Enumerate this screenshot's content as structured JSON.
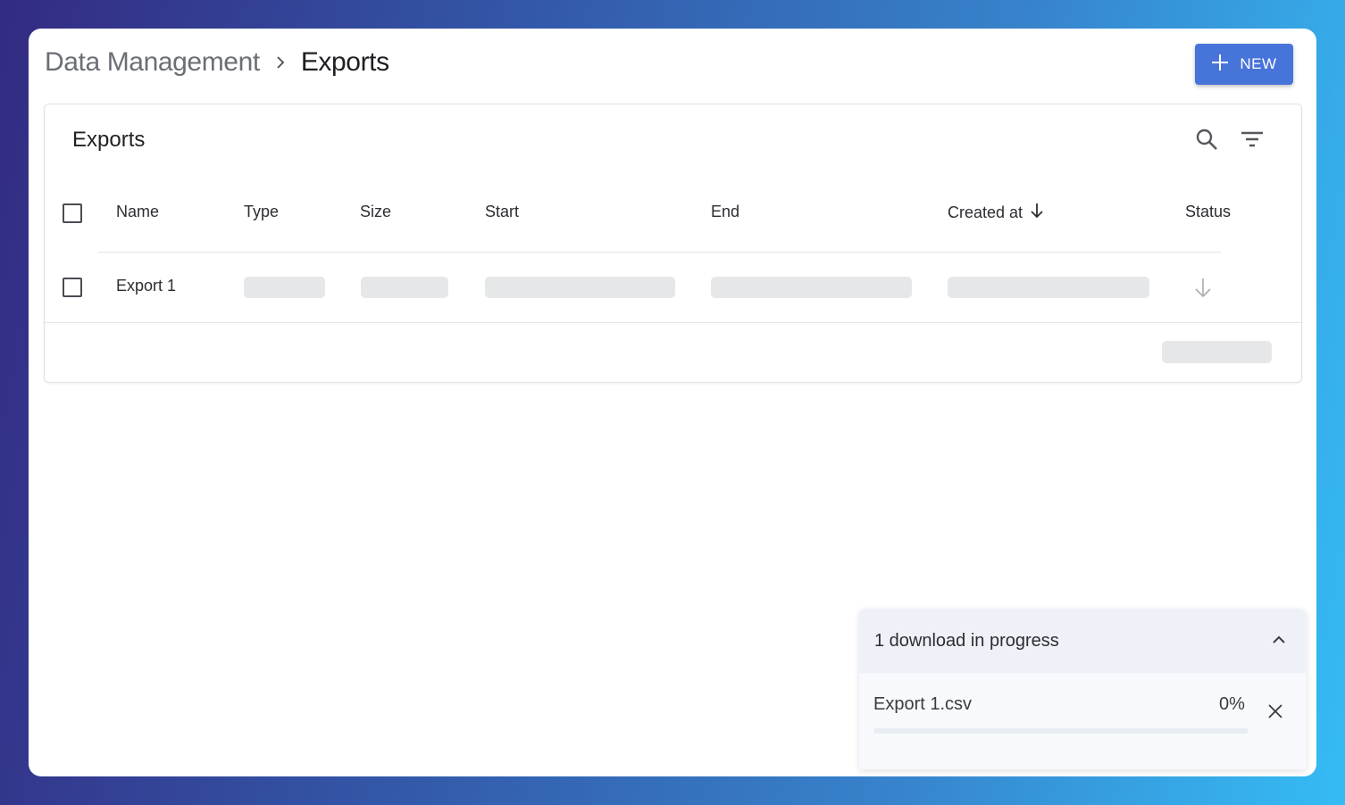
{
  "breadcrumb": {
    "parent": "Data Management",
    "current": "Exports"
  },
  "toolbar": {
    "new_label": "NEW"
  },
  "table": {
    "title": "Exports",
    "columns": [
      "Name",
      "Type",
      "Size",
      "Start",
      "End",
      "Created at",
      "Status"
    ],
    "sorted_column": "Created at",
    "sort_direction": "descending",
    "rows": [
      {
        "name": "Export 1",
        "status_icon": "arrow-down-icon"
      }
    ]
  },
  "downloads": {
    "title": "1 download in progress",
    "items": [
      {
        "filename": "Export 1.csv",
        "progress_text": "0%",
        "progress": 0
      }
    ]
  },
  "colors": {
    "accent": "#4774d9",
    "skeleton": "#e6e7e9"
  },
  "icons": [
    "chevron-right-icon",
    "plus-icon",
    "search-icon",
    "filter-icon",
    "sort-arrow-down-icon",
    "arrow-down-icon",
    "chevron-up-icon",
    "close-icon"
  ]
}
